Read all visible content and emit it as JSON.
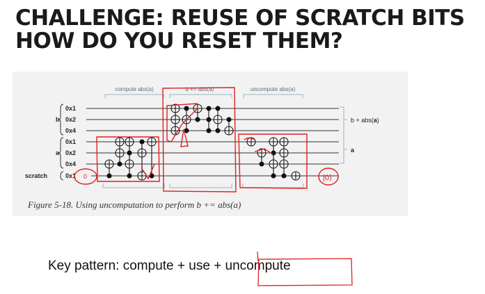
{
  "title": {
    "line1": "CHALLENGE: REUSE OF SCRATCH BITS",
    "line2": "HOW DO YOU RESET THEM?"
  },
  "figure": {
    "sections": [
      "compute abs(a)",
      "b += abs(a)",
      "uncompute abs(a)"
    ],
    "qubit_labels": [
      "0x1",
      "0x2",
      "0x4",
      "0x1",
      "0x2",
      "0x4",
      "0x1"
    ],
    "register_labels": {
      "b": "b",
      "a": "a",
      "scratch": "scratch"
    },
    "output_labels": {
      "b": "b + abs(",
      "b_a": "a",
      "b_close": ")",
      "a": "a"
    },
    "scratch_in": "0",
    "scratch_out": "|0⟩",
    "caption": "Figure 5-18. Using uncomputation to perform b += abs(a)"
  },
  "key_pattern": {
    "prefix": "Key pattern: compute + use + ",
    "highlighted": "uncompute"
  },
  "colors": {
    "annotation": "#e02020",
    "circuit": "#222222",
    "bracket": "#a9c4cc"
  }
}
